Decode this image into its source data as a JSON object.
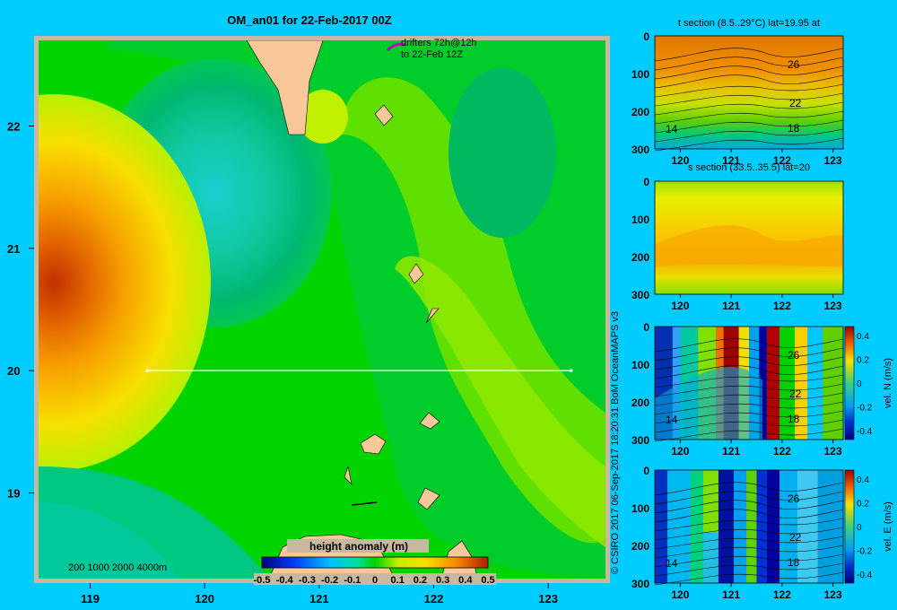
{
  "title": "OM_an01 for 22-Feb-2017 00Z",
  "credit": "© CSIRO 2017   06-Sep-2017 18:20:31 BoM OceanMAPS v3",
  "drifters": {
    "line1": "drifters 72h@12h",
    "line2": "to 22-Feb 12Z"
  },
  "depth_legend": "200  1000  2000  4000m",
  "colors": {
    "background": "#00ccff",
    "land": "#f8c89a",
    "section_line": "#ffffff"
  },
  "chart_data": [
    {
      "type": "heatmap",
      "name": "map",
      "title": "OM_an01 for 22-Feb-2017 00Z",
      "x_ticks": [
        "119",
        "120",
        "121",
        "122",
        "123"
      ],
      "y_ticks": [
        "19",
        "20",
        "21",
        "22"
      ],
      "xlim": [
        118.55,
        123.5
      ],
      "ylim": [
        18.3,
        22.7
      ],
      "colorbar": {
        "label": "height anomaly (m)",
        "ticks": [
          "-0.5",
          "-0.4",
          "-0.3",
          "-0.2",
          "-0.1",
          "0",
          "0.1",
          "0.2",
          "0.3",
          "0.4",
          "0.5"
        ],
        "range": [
          -0.5,
          0.5
        ]
      },
      "section_line": {
        "lat": 20,
        "lon": [
          119.5,
          123.2
        ]
      },
      "features": [
        {
          "kind": "high",
          "lon": 118.7,
          "lat": 20.7,
          "value": 0.45
        },
        {
          "kind": "low",
          "lon": 120.05,
          "lat": 21.5,
          "value": -0.2
        },
        {
          "kind": "low",
          "lon": 122.4,
          "lat": 21.8,
          "value": -0.05
        }
      ]
    },
    {
      "type": "heatmap",
      "name": "t-section",
      "title": "t section (8.5..29°C) lat=19.95 at",
      "x_ticks": [
        "120",
        "121",
        "122",
        "123"
      ],
      "y_ticks": [
        "0",
        "100",
        "200",
        "300"
      ],
      "contour_labels": [
        "26",
        "22",
        "18",
        "14"
      ]
    },
    {
      "type": "heatmap",
      "name": "s-section",
      "title": "s section (33.5..35.5) lat=20",
      "x_ticks": [
        "120",
        "121",
        "122",
        "123"
      ],
      "y_ticks": [
        "0",
        "100",
        "200",
        "300"
      ]
    },
    {
      "type": "heatmap",
      "name": "vN-section",
      "x_ticks": [
        "120",
        "121",
        "122",
        "123"
      ],
      "y_ticks": [
        "0",
        "100",
        "200",
        "300"
      ],
      "contour_labels": [
        "26",
        "22",
        "18",
        "14"
      ],
      "colorbar": {
        "label": "vel. N (m/s)",
        "ticks": [
          "0.4",
          "0.2",
          "0",
          "-0.2",
          "-0.4"
        ]
      }
    },
    {
      "type": "heatmap",
      "name": "vE-section",
      "x_ticks": [
        "120",
        "121",
        "122",
        "123"
      ],
      "y_ticks": [
        "0",
        "100",
        "200",
        "300"
      ],
      "contour_labels": [
        "26",
        "22",
        "18",
        "14"
      ],
      "colorbar": {
        "label": "vel. E (m/s)",
        "ticks": [
          "0.4",
          "0.2",
          "0",
          "-0.2",
          "-0.4"
        ]
      }
    }
  ]
}
